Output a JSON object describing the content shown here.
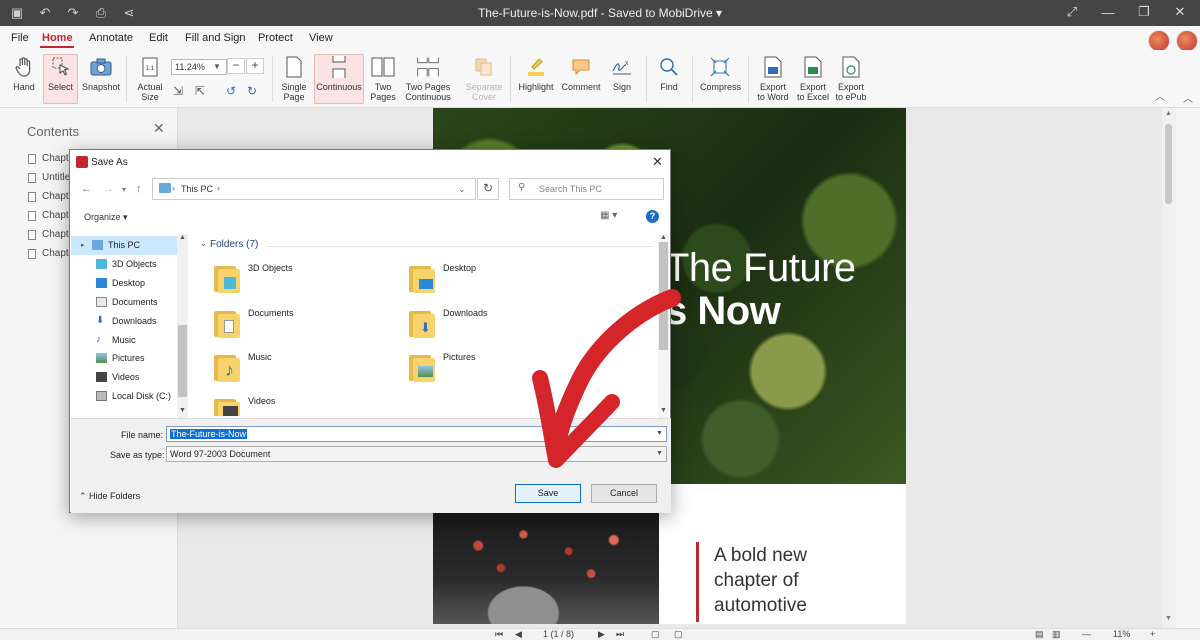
{
  "window": {
    "title": "The-Future-is-Now.pdf - Saved to MobiDrive ▾"
  },
  "menu": {
    "items": [
      "File",
      "Home",
      "Annotate",
      "Edit",
      "Fill and Sign",
      "Protect",
      "View"
    ],
    "active": "Home"
  },
  "ribbon": {
    "hand": "Hand",
    "select": "Select",
    "snapshot": "Snapshot",
    "actual_size_1": "Actual",
    "actual_size_2": "Size",
    "zoom_value": "11.24%",
    "single_page_1": "Single",
    "single_page_2": "Page",
    "continuous": "Continuous",
    "two_pages_1": "Two",
    "two_pages_2": "Pages",
    "two_pages_cont_1": "Two Pages",
    "two_pages_cont_2": "Continuous",
    "separate_cover_1": "Separate",
    "separate_cover_2": "Cover",
    "highlight": "Highlight",
    "comment": "Comment",
    "sign": "Sign",
    "find": "Find",
    "compress": "Compress",
    "export_word_1": "Export",
    "export_word_2": "to Word",
    "export_excel_1": "Export",
    "export_excel_2": "to Excel",
    "export_epub_1": "Export",
    "export_epub_2": "to ePub"
  },
  "contents": {
    "title": "Contents",
    "items": [
      "Chapte",
      "Untitle",
      "Chapte",
      "Chapte",
      "Chapte",
      "Chapte"
    ]
  },
  "document": {
    "title_line1": "The Future",
    "title_line2": "s Now",
    "page2_text": "A bold new chapter of automotive"
  },
  "statusbar": {
    "page_indicator": "1 (1 / 8)",
    "zoom": "11%"
  },
  "dialog": {
    "title": "Save As",
    "address": "This PC",
    "search_placeholder": "Search This PC",
    "organize": "Organize ▾",
    "help": "?",
    "nav_items": [
      "This PC",
      "3D Objects",
      "Desktop",
      "Documents",
      "Downloads",
      "Music",
      "Pictures",
      "Videos",
      "Local Disk (C:)"
    ],
    "folders_header": "Folders (7)",
    "folders": [
      "3D Objects",
      "Desktop",
      "Documents",
      "Downloads",
      "Music",
      "Pictures",
      "Videos"
    ],
    "file_name_label": "File name:",
    "file_name_value": "The-Future-is-Now",
    "save_type_label": "Save as type:",
    "save_type_value": "Word 97-2003 Document",
    "hide_folders": "Hide Folders",
    "save": "Save",
    "cancel": "Cancel"
  },
  "colors": {
    "accent": "#c1272d",
    "titlebar": "#454545",
    "selection": "#0f6fd1"
  }
}
